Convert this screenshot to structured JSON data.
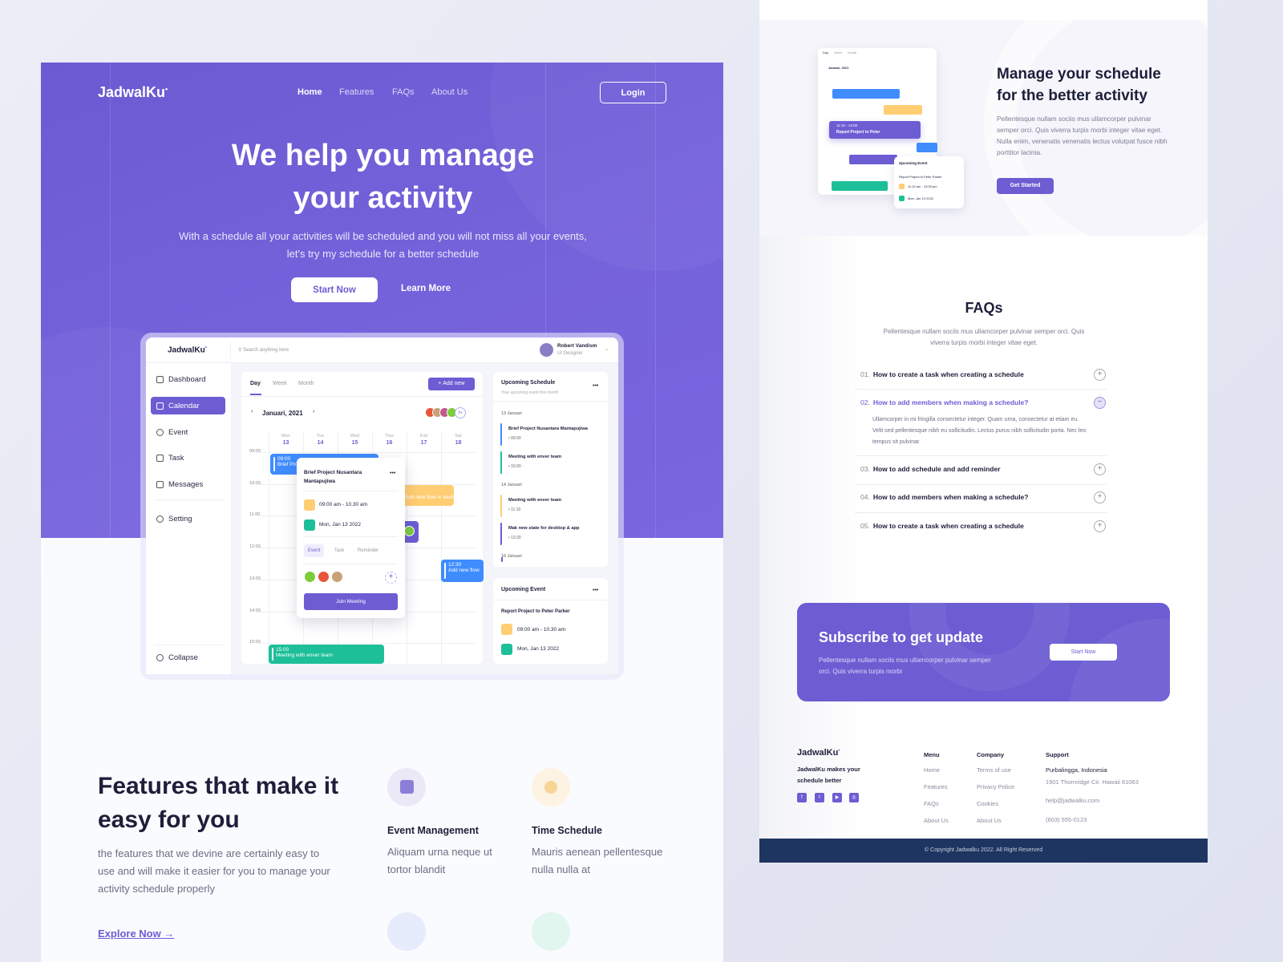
{
  "brand": "JadwalKu",
  "colors": {
    "primary": "#6c5dd3",
    "blue": "#3f8cff",
    "yellow": "#ffce73",
    "green": "#1dbf98",
    "navy": "#1e3461"
  },
  "hero": {
    "nav": [
      "Home",
      "Features",
      "FAQs",
      "About Us"
    ],
    "login": "Login",
    "title_line1": "We help you manage",
    "title_line2": "your activity",
    "subtitle": "With a schedule all your activities will be scheduled and you will not miss all your events, let's try my schedule for a better schedule",
    "start": "Start Now",
    "learn": "Learn More"
  },
  "dashboard": {
    "search_placeholder": "Search anything here",
    "user_name": "Robert Vandism",
    "user_role": "UI Designer",
    "sidebar": [
      "Dashboard",
      "Calendar",
      "Event",
      "Task",
      "Messages",
      "Setting"
    ],
    "collapse": "Collapse",
    "tabs": [
      "Day",
      "Week",
      "Month"
    ],
    "add_new": "+ Add new",
    "month": "Januari, 2021",
    "more_count": "3+",
    "days": [
      {
        "d": "Mon",
        "n": "13"
      },
      {
        "d": "Tue",
        "n": "14"
      },
      {
        "d": "Wed",
        "n": "15"
      },
      {
        "d": "Thur",
        "n": "16"
      },
      {
        "d": "Frid",
        "n": "17"
      },
      {
        "d": "Sat",
        "n": "18"
      }
    ],
    "times": [
      "09:00",
      "10:00",
      "11:00",
      "12:00",
      "13:00",
      "14:00",
      "15:00"
    ],
    "events": [
      {
        "time": "09:00",
        "title": "Brief Project Nusantara Mantapujiwa"
      },
      {
        "time": "10:00",
        "title": "Add new flow in dashboard"
      },
      {
        "time": "12:30",
        "title": "Add new flow"
      },
      {
        "time": "15:00",
        "title": "Meeting with enver team"
      }
    ],
    "popup": {
      "title": "Brief Project Nusantara Mantapujiwa",
      "time": "09:00 am - 10.30 am",
      "date": "Mon, Jan 13 2022",
      "tabs": [
        "Event",
        "Task",
        "Reminder"
      ],
      "join": "Join Meeting"
    },
    "upcoming_schedule": {
      "title": "Upcoming Schedule",
      "subtitle": "Your upcoming event this month",
      "groups": [
        {
          "date": "13 Januari",
          "items": [
            {
              "title": "Brief Project Nusantara Mantapujiwa",
              "time": "09:00",
              "color": "#3f8cff"
            },
            {
              "title": "Meeting with enver team",
              "time": "15:00",
              "color": "#1dbf98"
            }
          ]
        },
        {
          "date": "14 Januari",
          "items": [
            {
              "title": "Meeting with enver team",
              "time": "11:10",
              "color": "#ffce73"
            },
            {
              "title": "Mak new state for desktop & app",
              "time": "13:30",
              "color": "#6c5dd3"
            }
          ]
        },
        {
          "date": "16 Januari",
          "items": []
        }
      ]
    },
    "upcoming_event": {
      "title": "Upcoming Event",
      "name": "Report Project to Peter Parker",
      "time": "09:00 am - 10.30 am",
      "date": "Mon, Jan 13 2022"
    }
  },
  "features": {
    "title": "Features that make it easy for you",
    "desc": "the features that we devine are certainly easy to use and will make it easier for you to manage your activity schedule properly",
    "explore": "Explore Now",
    "items": [
      {
        "title": "Event Management",
        "desc": "Aliquam urna neque ut tortor blandit",
        "icon": "calendar-icon"
      },
      {
        "title": "Time Schedule",
        "desc": "Mauris aenean pellentesque nulla nulla at",
        "icon": "timer-icon"
      }
    ]
  },
  "manage": {
    "title": "Manage your schedule for the better activity",
    "desc": "Pellentesque nullam sociis mus ullamcorper pulvinar semper orci. Quis viverra turpis morbi integer vitae eget. Nulla enim, venenatis venenatis lectus volutpat fusce nibh porttitor lacinia.",
    "button": "Get Started",
    "mini": {
      "tabs": [
        "Day",
        "Week",
        "Month"
      ],
      "month": "Januari, 2021",
      "highlight_time": "11:10 - 13:00",
      "highlight_title": "Report Project to Peter",
      "card_title": "Upcoming Event",
      "card_name": "Report Project to Peter Parker",
      "card_time": "11:10 am - 13:00 pm",
      "card_date": "Mon, Jan 13 2022"
    }
  },
  "faq": {
    "title": "FAQs",
    "subtitle": "Pellentesque nullam sociis mus ullamcorper pulvinar semper orci. Quis viverra turpis morbi integer vitae eget.",
    "items": [
      {
        "num": "01.",
        "q": "How to create a task when creating a schedule"
      },
      {
        "num": "02.",
        "q": "How to add members when making a schedule?",
        "a": "Ullamcorper in mi fringilla consectetur integer. Quam urna, consectetur at etiam eu. Velit sed pellentesque nibh eu sollicitudin. Lectus purus nibh sollicitudin porta. Nec leo tempus sit pulvinar."
      },
      {
        "num": "03.",
        "q": "How to add schedule and add reminder"
      },
      {
        "num": "04.",
        "q": "How to add members when making a schedule?"
      },
      {
        "num": "05.",
        "q": "How to create a task when creating a schedule"
      }
    ]
  },
  "subscribe": {
    "title": "Subscribe to get update",
    "desc": "Pellentesque nullam sociis mus ullamcorper pulvinar semper orci. Quis viverra turpis morbi",
    "button": "Start Now"
  },
  "footer": {
    "tagline": "JadwalKu makes your schedule better",
    "menu": {
      "title": "Menu",
      "items": [
        "Home",
        "Features",
        "FAQs",
        "About Us"
      ]
    },
    "company": {
      "title": "Company",
      "items": [
        "Terms of use",
        "Privacy Police",
        "Cookies",
        "About Us"
      ]
    },
    "support": {
      "title": "Support",
      "city": "Purbalingga, Indonesia",
      "address": "1901 Thornridge Cir. Hawaii 81063",
      "email": "help@jadwalku.com",
      "phone": "(603) 555-0123"
    },
    "copyright": "© Copyright Jadwalku 2022. All Right Reserved"
  }
}
